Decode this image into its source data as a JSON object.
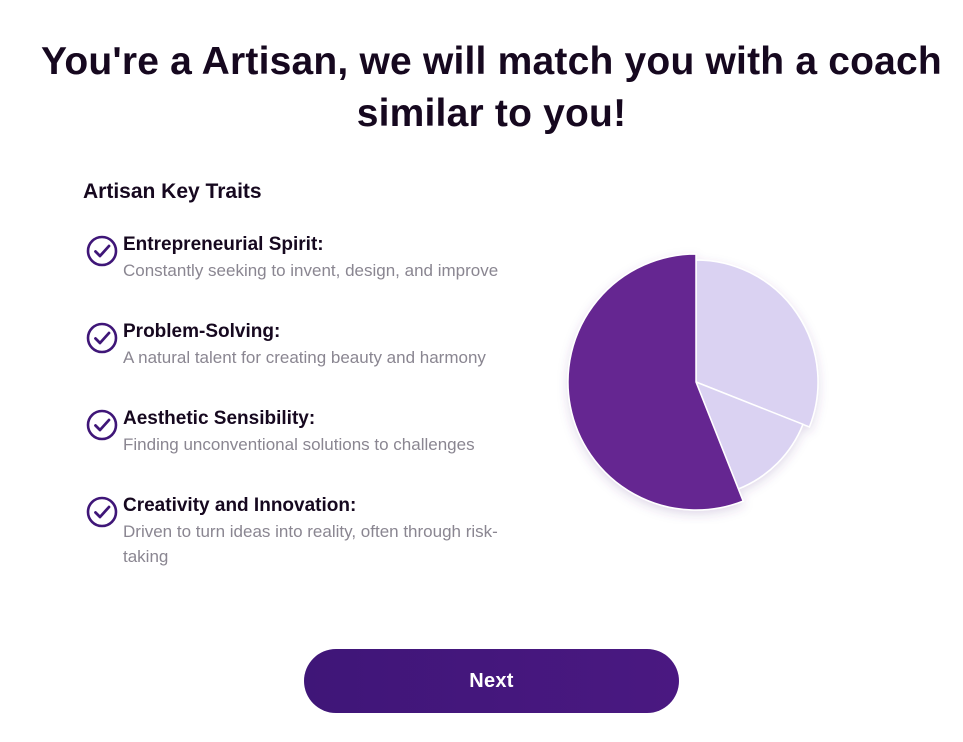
{
  "header": {
    "title": "You're a Artisan, we will match you with a coach similar to you!"
  },
  "traits": {
    "heading": "Artisan Key Traits",
    "items": [
      {
        "name": "Entrepreneurial Spirit:",
        "description": "Constantly seeking to invent, design, and improve"
      },
      {
        "name": "Problem-Solving:",
        "description": "A natural talent for creating beauty and harmony"
      },
      {
        "name": "Aesthetic Sensibility:",
        "description": "Finding unconventional solutions to challenges"
      },
      {
        "name": "Creativity and Innovation:",
        "description": "Driven to turn ideas into reality, often through risk-taking"
      }
    ]
  },
  "chart_data": {
    "type": "pie",
    "values": [
      31,
      13,
      56
    ],
    "colors": [
      "#dad2f2",
      "#dad2f2",
      "#652591"
    ]
  },
  "actions": {
    "next_label": "Next"
  },
  "colors": {
    "primary": "#4a1881",
    "accent": "#652591",
    "light": "#dad2f2",
    "icon": "#3f1678"
  },
  "icons": {
    "trait": "check-circle-icon"
  }
}
